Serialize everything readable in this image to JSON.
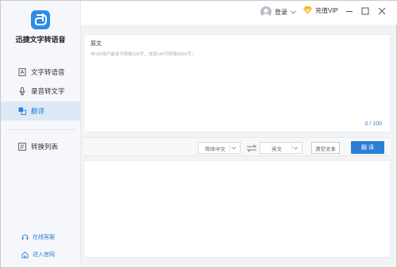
{
  "app": {
    "title": "迅捷文字转语音"
  },
  "sidebar": {
    "items": [
      {
        "label": "文字转语音",
        "icon": "text-to-speech-icon",
        "active": false
      },
      {
        "label": "录音转文字",
        "icon": "microphone-icon",
        "active": false
      },
      {
        "label": "翻译",
        "icon": "translate-icon",
        "active": true
      },
      {
        "label": "转换列表",
        "icon": "convert-list-icon",
        "active": false
      }
    ],
    "links": [
      {
        "label": "在线客服",
        "icon": "customer-service-icon"
      },
      {
        "label": "进入官网",
        "icon": "website-icon"
      }
    ]
  },
  "topbar": {
    "login_label": "登录",
    "vip_label": "充值VIP"
  },
  "source": {
    "label": "原文",
    "hint": "非VIP用户最多可转换100字，充值VIP可转换4000字。",
    "counter": "0 / 100"
  },
  "toolbar": {
    "source_lang": "简体中文",
    "target_lang": "英文",
    "clear_label": "清空文本",
    "translate_label": "翻 译"
  },
  "colors": {
    "accent": "#2b7fd7",
    "vip_badge": "#f5b829",
    "active_nav_bg": "#dde9f7"
  }
}
